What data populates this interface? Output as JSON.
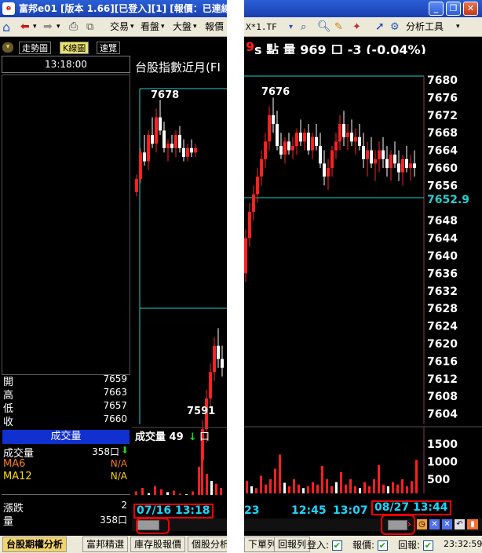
{
  "window": {
    "title": "富邦e01 [版本 1.66][已登入][1] [報價：已連線",
    "minimize": "_",
    "restore": "❐",
    "close": "✕"
  },
  "toolbar": {
    "menu_trade": "交易",
    "menu_view": "看盤",
    "menu_market": "大盤",
    "menu_quote": "報價",
    "symbol": "X*1.TF",
    "menu_tools": "分析工具"
  },
  "tabs": {
    "trend": "走勢圖",
    "kline": "K線圖",
    "tick": "速覽"
  },
  "sidebar": {
    "time": "13:18:00",
    "open_label": "開",
    "open_value": "7659",
    "high_label": "高",
    "high_value": "7663",
    "low_label": "低",
    "low_value": "7657",
    "close_label": "收",
    "close_value": "7660",
    "volume_header": "成交量",
    "volume_label": "成交量",
    "volume_value": "358口",
    "ma6_label": "MA6",
    "ma6_value": "N/A",
    "ma12_label": "MA12",
    "ma12_value": "N/A",
    "change_label": "漲跌",
    "change_value": "2",
    "qty_label": "量",
    "qty_value": "358口"
  },
  "chart_header": {
    "title_left": "台股指數近月(FI",
    "title_right_num": "9",
    "title_right_rest": "s 點  量 969 口  -3 (-0.04%)"
  },
  "chart_data": {
    "type": "candlestick",
    "y_ticks": [
      "7680",
      "7676",
      "7672",
      "7668",
      "7664",
      "7660",
      "7656",
      "7652.9",
      "7648",
      "7644",
      "7640",
      "7636",
      "7632",
      "7628",
      "7624",
      "7620",
      "7616",
      "7612",
      "7608",
      "7604"
    ],
    "reference_price": "7652.9",
    "ylim": [
      7602,
      7682
    ],
    "annotations": {
      "left_high": "7678",
      "left_low": "7591",
      "right_high": "7676"
    },
    "volume_label": "成交量 49",
    "volume_unit": "口",
    "volume_ticks": [
      "1500",
      "1000",
      "500"
    ],
    "x_ticks": [
      "23",
      "12:45",
      "13:07"
    ],
    "start_date": "07/16 13:18",
    "end_date": "08/27 13:44"
  },
  "bottom_tabs": {
    "t1": "台股期權分析",
    "t2": "富邦精選",
    "t3": "庫存股報價",
    "t4": "個股分析",
    "t5": "下單列",
    "t6": "回報列",
    "login": "登入:",
    "quote": "報價:",
    "report": "回報:",
    "clock": "23:32:59"
  },
  "colors": {
    "up": "#ff2020",
    "down": "#ffffff",
    "ref_line": "#25d0d0",
    "axis_text": "#ffffff",
    "date_text": "#1ad6ff"
  }
}
